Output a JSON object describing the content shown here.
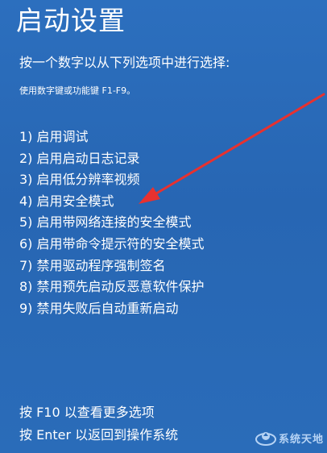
{
  "screen": {
    "title": "启动设置",
    "instruction": "按一个数字以从下列选项中进行选择:",
    "hint": "使用数字键或功能键 F1-F9。",
    "options": [
      "1) 启用调试",
      "2) 启用启动日志记录",
      "3) 启用低分辨率视频",
      "4) 启用安全模式",
      "5) 启用带网络连接的安全模式",
      "6) 启用带命令提示符的安全模式",
      "7) 禁用驱动程序强制签名",
      "8) 禁用预先启动反恶意软件保护",
      "9) 禁用失败后自动重新启动"
    ],
    "footer": {
      "more_options": "按 F10 以查看更多选项",
      "return_os": "按 Enter 以返回到操作系统"
    }
  },
  "annotation": {
    "arrow_color": "#e8312f",
    "arrow_target": "4) 启用安全模式"
  },
  "watermark": {
    "text": "系统天地",
    "icon": "site-logo-icon"
  },
  "colors": {
    "background": "#2a6bb8",
    "text": "#ffffff"
  }
}
